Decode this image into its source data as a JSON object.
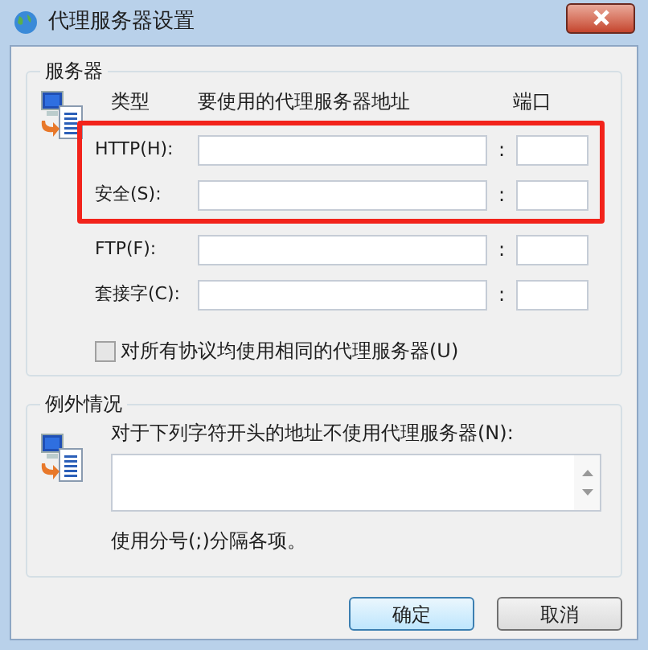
{
  "window": {
    "title": "代理服务器设置"
  },
  "servers": {
    "legend": "服务器",
    "columns": [
      "类型",
      "要使用的代理服务器地址",
      "端口"
    ],
    "rows": [
      {
        "label": "HTTP(H):",
        "separator": ":",
        "highlighted": true
      },
      {
        "label": "安全(S):",
        "separator": ":",
        "highlighted": true
      },
      {
        "label": "FTP(F):",
        "separator": ":",
        "highlighted": false
      },
      {
        "label": "套接字(C):",
        "separator": ":",
        "highlighted": false
      }
    ],
    "same_proxy": {
      "label": "对所有协议均使用相同的代理服务器(U)",
      "checked": false,
      "disabled": true
    }
  },
  "exceptions": {
    "legend": "例外情况",
    "prompt": "对于下列字符开头的地址不使用代理服务器(N):",
    "note": "使用分号(;)分隔各项。"
  },
  "buttons": [
    {
      "label": "确定",
      "default": true
    },
    {
      "label": "取消",
      "default": false
    }
  ]
}
